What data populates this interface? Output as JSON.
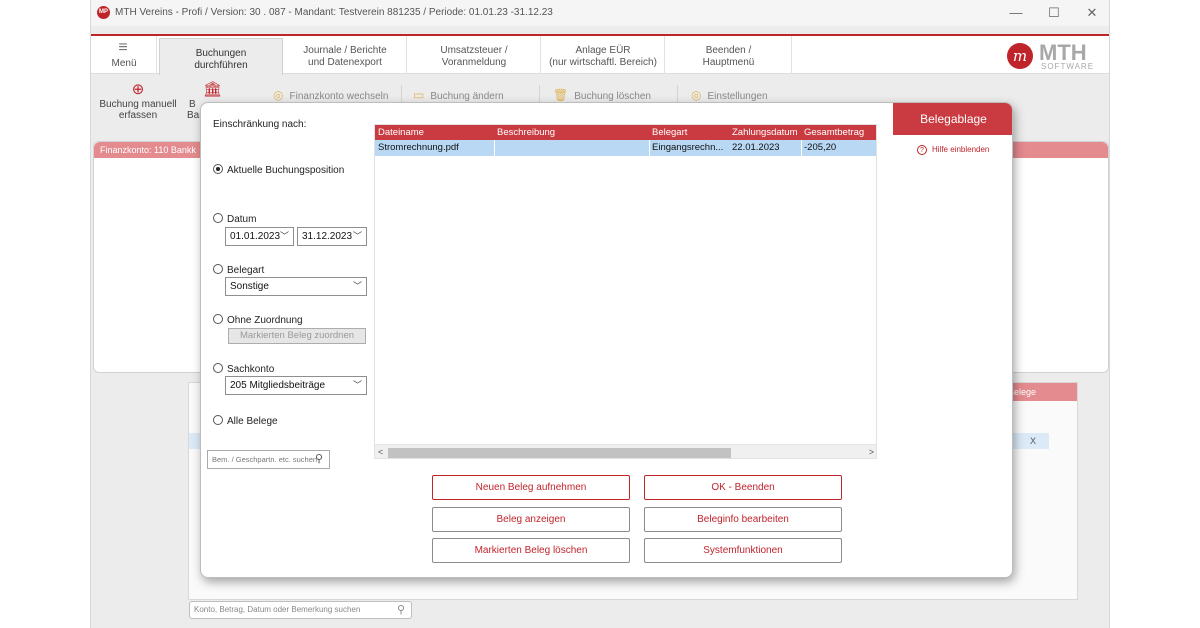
{
  "window": {
    "logo_text": "MP",
    "title": "MTH Vereins - Profi  /  Version: 30 . 087   -   Mandant: Testverein 881235  /  Periode: 01.01.23 -31.12.23",
    "minimize": "—",
    "maximize": "☐",
    "close": "✕"
  },
  "menubar": {
    "menu_icon": "≡",
    "menu_label": "Menü",
    "tabs": [
      {
        "line1": "Buchungen",
        "line2": "durchführen"
      },
      {
        "line1": "Journale / Berichte",
        "line2": "und Datenexport"
      },
      {
        "line1": "Umsatzsteuer /",
        "line2": "Voranmeldung"
      },
      {
        "line1": "Anlage EÜR",
        "line2": "(nur wirtschaftl. Bereich)"
      },
      {
        "line1": "Beenden /",
        "line2": "Hauptmenü"
      }
    ],
    "brand": {
      "mark": "m",
      "name": "MTH",
      "sub": "SOFTWARE"
    }
  },
  "toolbar": {
    "buchung_manuell": {
      "icon": "⊕",
      "line1": "Buchung manuell",
      "line2": "erfassen"
    },
    "bank": {
      "icon": "🏛",
      "line1": "B",
      "line2": "Ban"
    },
    "finanzkonto_wechseln": {
      "icon": "◎",
      "label": "Finanzkonto wechseln"
    },
    "buchung_aendern": {
      "icon": "▭",
      "label": "Buchung ändern"
    },
    "buchung_loeschen": {
      "icon": "🗑",
      "label": "Buchung löschen"
    },
    "einstellungen": {
      "icon": "◎",
      "label": "Einstellungen"
    }
  },
  "background": {
    "finanzkonto_header": "Finanzkonto: 110 Bankk",
    "belege_header": "Belege",
    "row_close": "X",
    "bottom_search_placeholder": "Konto, Betrag, Datum oder Bemerkung suchen",
    "search_icon": "⚲"
  },
  "dialog": {
    "filter_title": "Einschränkung nach:",
    "options": {
      "aktuelle": "Aktuelle Buchungsposition",
      "datum": "Datum",
      "date_from": "01.01.2023",
      "date_to": "31.12.2023",
      "belegart": "Belegart",
      "belegart_value": "Sonstige",
      "ohne_zuordnung": "Ohne Zuordnung",
      "assign_button": "Markierten Beleg zuordnen",
      "sachkonto": "Sachkonto",
      "sachkonto_value": "205 Mitgliedsbeiträge",
      "alle_belege": "Alle Belege"
    },
    "search_placeholder": "Bem. / Geschpartn. etc. suchen",
    "table": {
      "columns": [
        "Dateiname",
        "Beschreibung",
        "Belegart",
        "Zahlungsdatum",
        "Gesamtbetrag"
      ],
      "rows": [
        {
          "dateiname": "Stromrechnung.pdf",
          "beschreibung": "",
          "belegart": "Eingangsrechn...",
          "zahlungsdatum": "22.01.2023",
          "gesamtbetrag": "-205,20"
        }
      ],
      "scroll_left": "<",
      "scroll_right": ">"
    },
    "buttons": {
      "neuer_beleg": "Neuen Beleg aufnehmen",
      "ok_beenden": "OK - Beenden",
      "beleg_anzeigen": "Beleg anzeigen",
      "beleginfo": "Beleginfo bearbeiten",
      "markierten_loeschen": "Markierten Beleg löschen",
      "systemfunktionen": "Systemfunktionen"
    },
    "side": {
      "title": "Belegablage",
      "help_icon": "?",
      "help_label": "Hilfe einblenden"
    }
  },
  "colors": {
    "accent": "#c0242b",
    "header_red": "#c93b40",
    "soft_red": "#e48b8f",
    "selection_blue": "#b8d8f4"
  }
}
